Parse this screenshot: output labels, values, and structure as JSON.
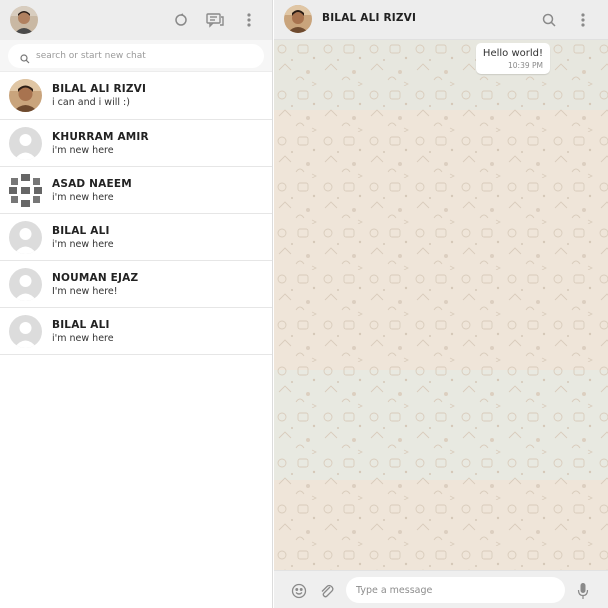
{
  "sidebar": {
    "search": {
      "placeholder": "search or start new chat"
    },
    "icons": [
      "refresh-icon",
      "chat-icon",
      "more-vertical-icon"
    ],
    "chats": [
      {
        "name": "BILAL ALI RIZVI",
        "status": "i can and i will :)",
        "avatar": "photo"
      },
      {
        "name": "KHURRAM AMIR",
        "status": "i'm new here",
        "avatar": "default"
      },
      {
        "name": "ASAD NAEEM",
        "status": "i'm new here",
        "avatar": "pattern"
      },
      {
        "name": "BILAL ALI",
        "status": "i'm new here",
        "avatar": "default"
      },
      {
        "name": "NOUMAN EJAZ",
        "status": "I'm new here!",
        "avatar": "default"
      },
      {
        "name": "BILAL ALI",
        "status": "i'm new here",
        "avatar": "default"
      }
    ]
  },
  "main": {
    "contact_name": "BILAL ALI RIZVI",
    "icons": [
      "search-icon",
      "more-vertical-icon"
    ],
    "messages": [
      {
        "text": "Hello world!",
        "time": "10:39 PM",
        "direction": "outgoing"
      }
    ],
    "composer": {
      "placeholder": "Type a message",
      "icons": [
        "emoji-icon",
        "attach-icon",
        "mic-icon"
      ]
    }
  },
  "colors": {
    "header_bg": "#ededed",
    "wallpaper": "#efe6da",
    "icon": "#8a8a8a"
  }
}
